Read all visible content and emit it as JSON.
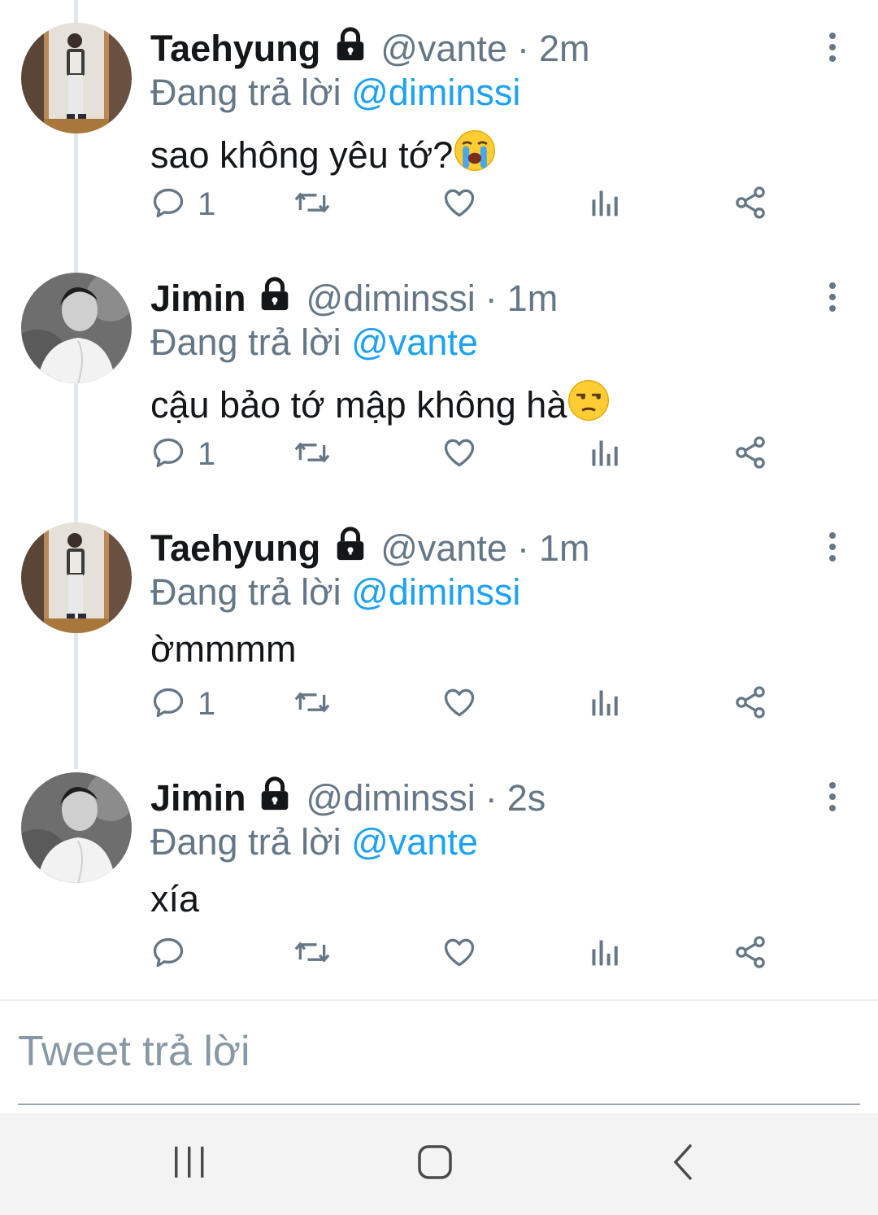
{
  "tweets": [
    {
      "name": "Taehyung",
      "handle": "@vante",
      "sep": "·",
      "time": "2m",
      "replying_prefix": "Đang trả lời",
      "replying_to": "@diminssi",
      "text": "sao không yêu tớ?",
      "emoji": "😭",
      "reply_count": "1",
      "avatar": "taehyung-avatar"
    },
    {
      "name": "Jimin",
      "handle": "@diminssi",
      "sep": "·",
      "time": "1m",
      "replying_prefix": "Đang trả lời",
      "replying_to": "@vante",
      "text": "cậu bảo tớ mập không hà",
      "emoji": "😒",
      "reply_count": "1",
      "avatar": "jimin-avatar"
    },
    {
      "name": "Taehyung",
      "handle": "@vante",
      "sep": "·",
      "time": "1m",
      "replying_prefix": "Đang trả lời",
      "replying_to": "@diminssi",
      "text": "ờmmmm",
      "emoji": "",
      "reply_count": "1",
      "avatar": "taehyung-avatar"
    },
    {
      "name": "Jimin",
      "handle": "@diminssi",
      "sep": "·",
      "time": "2s",
      "replying_prefix": "Đang trả lời",
      "replying_to": "@vante",
      "text": "xía",
      "emoji": "",
      "reply_count": "",
      "avatar": "jimin-avatar"
    }
  ],
  "composer": {
    "placeholder": "Tweet trả lời"
  },
  "icons": {
    "lock": "lock-icon",
    "more": "more-vertical-icon",
    "reply": "reply-icon",
    "retweet": "retweet-icon",
    "like": "heart-icon",
    "analytics": "analytics-icon",
    "share": "share-icon"
  },
  "colors": {
    "mention": "#1da1f2",
    "secondary_text": "#657786",
    "primary_text": "#14171a",
    "icon": "#657786"
  }
}
